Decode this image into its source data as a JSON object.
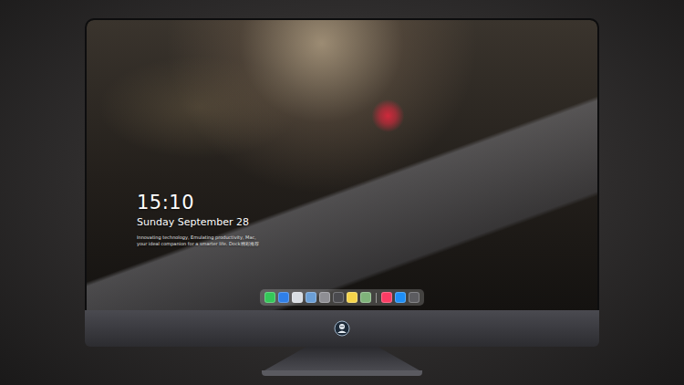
{
  "screen": {
    "clock": {
      "time": "15:10",
      "date": "Sunday September 28",
      "tagline": [
        "Innovating technology, Emulating productivity, Mac,",
        "your ideal companion for a smarter life. Dock精彩推荐"
      ]
    }
  },
  "dock": {
    "items": [
      {
        "kind": "app",
        "color": "#34c759"
      },
      {
        "kind": "app",
        "color": "#2f7fe8"
      },
      {
        "kind": "app",
        "color": "#d9dde3"
      },
      {
        "kind": "app",
        "color": "#6b9fd6"
      },
      {
        "kind": "app",
        "color": "#8e8e93"
      },
      {
        "kind": "app",
        "color": "#4a4a4e"
      },
      {
        "kind": "app",
        "color": "#f5d44a"
      },
      {
        "kind": "app",
        "color": "#7fb37a"
      },
      {
        "kind": "separator"
      },
      {
        "kind": "app",
        "color": "#fa3c64"
      },
      {
        "kind": "app",
        "color": "#1e8ef5"
      },
      {
        "kind": "app",
        "color": "#5c5c60"
      }
    ]
  }
}
